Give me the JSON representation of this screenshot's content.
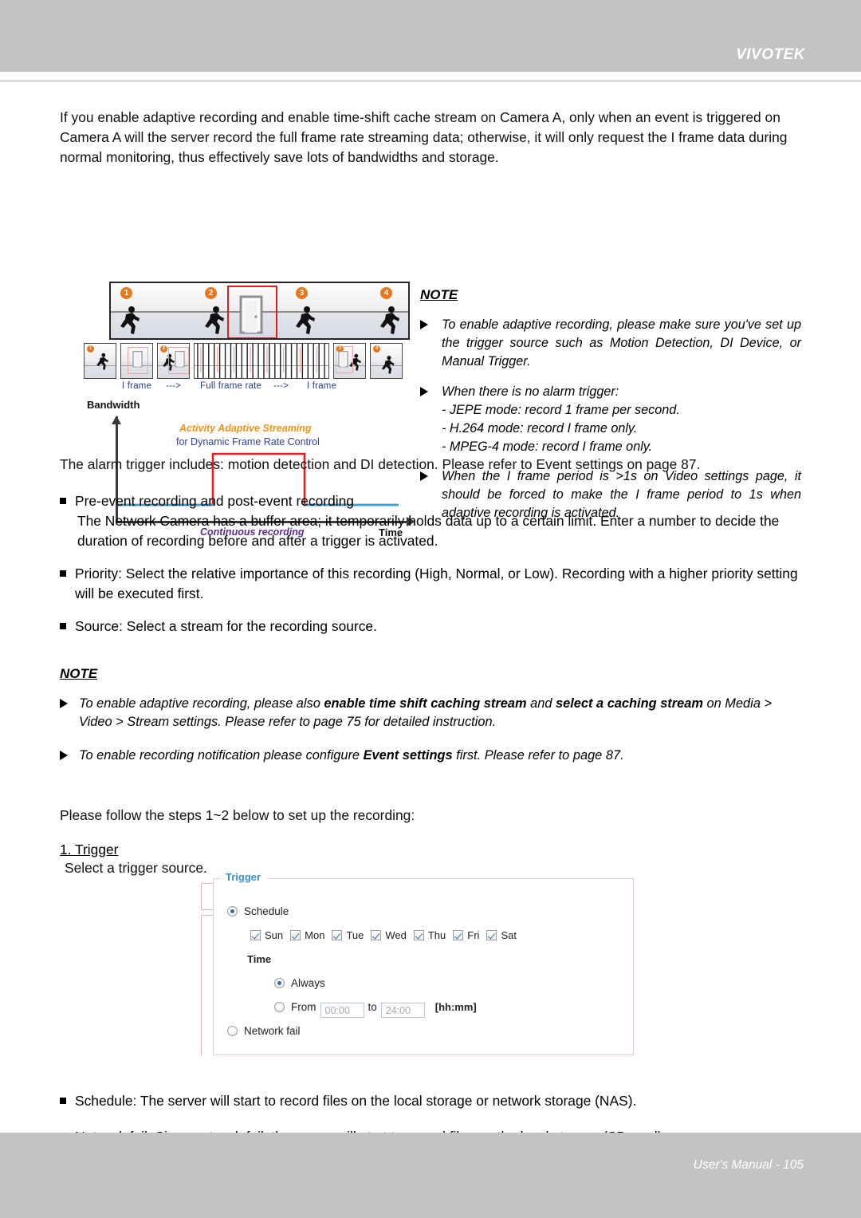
{
  "header": {
    "brand": "VIVOTEK"
  },
  "footer": {
    "text": "User's Manual - 105"
  },
  "intro": {
    "paragraph": "If you enable adaptive recording and enable time-shift cache stream on Camera A, only when an event is triggered on Camera A will the server record the full frame rate streaming data; otherwise, it will only request the I frame data during normal monitoring, thus effectively save lots of bandwidths and storage."
  },
  "figure": {
    "scene_badges": [
      "1",
      "2",
      "3",
      "4"
    ],
    "thumb_badges": [
      "1",
      "2",
      "3",
      "4"
    ],
    "frame_labels": {
      "i_frame_left": "I frame",
      "arrow_left": "--->",
      "full_frame_rate": "Full frame rate",
      "arrow_right": "--->",
      "i_frame_right": "I frame"
    },
    "chart": {
      "y_axis_label": "Bandwidth",
      "x_axis_label": "Time",
      "annotation_orange": "Activity Adaptive Streaming",
      "annotation_blue": "for Dynamic Frame Rate Control",
      "annotation_purple": "Continuous recording"
    }
  },
  "chart_data": {
    "type": "line",
    "title": "Activity Adaptive Streaming for Dynamic Frame Rate Control",
    "xlabel": "Time",
    "ylabel": "Bandwidth",
    "grid": false,
    "legend": null,
    "annotations": [
      "Activity Adaptive Streaming",
      "for Dynamic Frame Rate Control",
      "Continuous recording"
    ],
    "series": [
      {
        "name": "Continuous recording",
        "color": "#29a8e0",
        "x": [
          0,
          45,
          45,
          80,
          80,
          100
        ],
        "values": [
          10,
          10,
          10,
          10,
          10,
          10
        ]
      },
      {
        "name": "Activity Adaptive Streaming",
        "color": "#ee1c25",
        "x": [
          45,
          45,
          80,
          80
        ],
        "values": [
          10,
          88,
          88,
          10
        ]
      }
    ],
    "xlim": [
      0,
      100
    ],
    "ylim": [
      0,
      100
    ]
  },
  "note1": {
    "heading": "NOTE",
    "items": [
      "To enable adaptive recording, please make sure you've set up the trigger source such as Motion Detection, DI Device, or Manual Trigger.",
      "When there is no alarm trigger:",
      "When the I frame period is >1s on Video settings page, it should be forced to make the I frame period to 1s when adaptive recording is activated."
    ],
    "modes": [
      "- JEPE mode: record 1 frame per second.",
      "- H.264 mode: record I frame only.",
      "- MPEG-4 mode: record I frame only."
    ]
  },
  "body": {
    "alarm_trigger": "The alarm trigger includes: motion detection and DI detection. Please refer to Event settings on page 87.",
    "bullets": [
      {
        "title": "Pre-event recording and post-event recording",
        "detail": "The Network Camera has a buffer area; it temporarily holds data up to a certain limit. Enter a number to decide the duration of recording before and after a trigger is activated."
      },
      {
        "title": "Priority: Select the relative importance of this recording (High, Normal, or Low). Recording with a higher priority setting will be executed first.",
        "detail": ""
      },
      {
        "title": "Source: Select a stream for the recording source.",
        "detail": ""
      }
    ],
    "tail_bullets": [
      "Schedule: The server will start to record files on the local storage or network storage (NAS).",
      "Network fail: Since network fail, the server will start to record files on the local storage (SD card)."
    ]
  },
  "note2": {
    "heading": "NOTE",
    "item1": {
      "part1": "To enable adaptive recording, please also ",
      "bold1": "enable time shift caching stream",
      "part2": " and ",
      "bold2": "select a caching stream",
      "part3": " on Media > Video > Stream settings. Please refer to page 75 for detailed instruction."
    },
    "item2": {
      "part1": "To enable recording notification please configure ",
      "bold1": "Event settings",
      "part2": " first. Please refer to page 87."
    }
  },
  "steps": {
    "lead": "Please follow the steps 1~2 below to set up the recording:",
    "step1_title": "1. Trigger",
    "step1_sub": "Select a trigger source."
  },
  "trigger_form": {
    "legend": "Trigger",
    "schedule_label": "Schedule",
    "days": [
      "Sun",
      "Mon",
      "Tue",
      "Wed",
      "Thu",
      "Fri",
      "Sat"
    ],
    "time_label": "Time",
    "always_label": "Always",
    "from_label": "From",
    "to_label": "to",
    "from_value": "00:00",
    "to_value": "24:00",
    "format_hint": "[hh:mm]",
    "network_fail_label": "Network fail"
  },
  "colors": {
    "band": "#c2c4c4",
    "legend_blue": "#3a8fd1",
    "annotation_orange": "#f29212",
    "annotation_blue": "#32409a",
    "annotation_purple": "#5b2d91",
    "chart_red": "#ee1c25",
    "chart_cyan": "#29a8e0",
    "badge_orange": "#e8761a"
  }
}
